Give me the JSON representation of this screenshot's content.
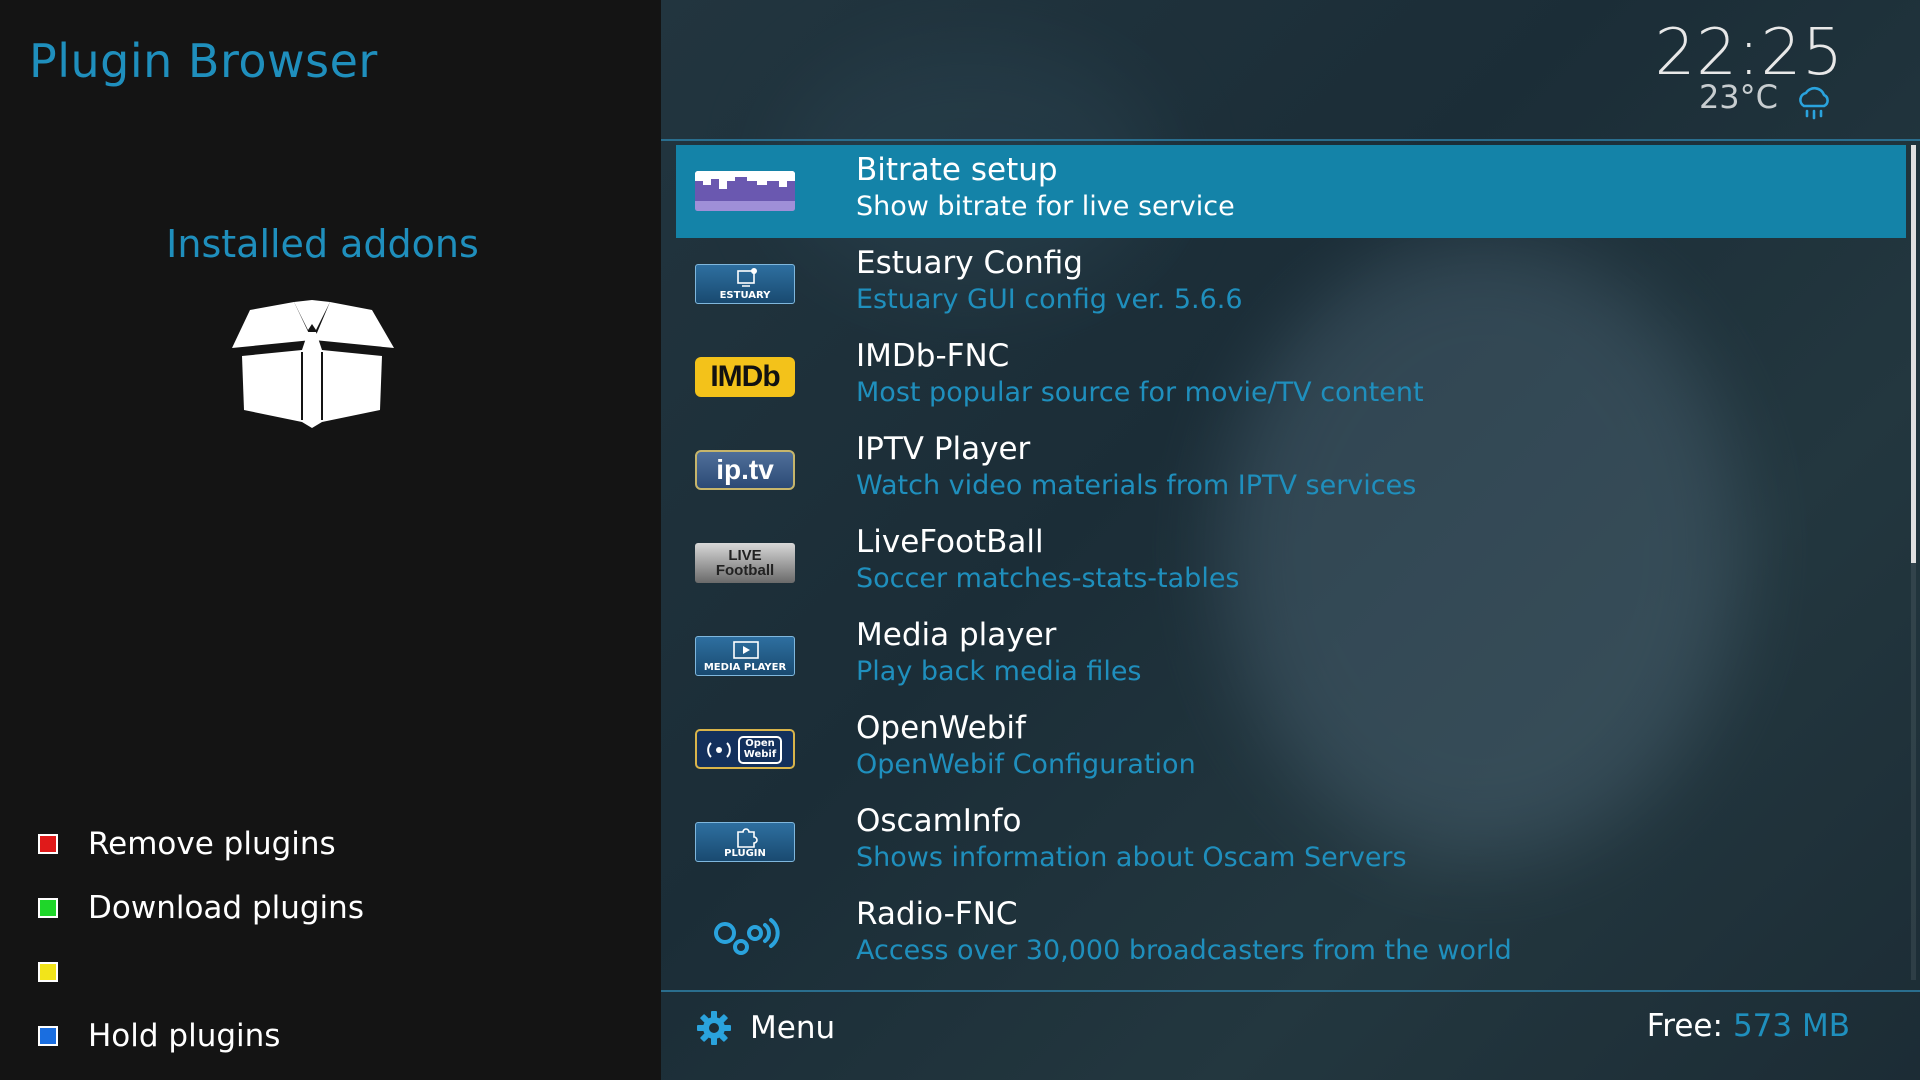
{
  "sidebar": {
    "title": "Plugin Browser",
    "section_title": "Installed addons",
    "section_icon": "open-box-icon",
    "color_keys": [
      {
        "color": "#e01a1a",
        "label": "Remove plugins"
      },
      {
        "color": "#1fd62a",
        "label": "Download plugins"
      },
      {
        "color": "#f2e41a",
        "label": ""
      },
      {
        "color": "#1a6ee0",
        "label": "Hold plugins"
      }
    ]
  },
  "header": {
    "time": "22:25",
    "temperature": "23°C",
    "weather_icon": "rain-cloud-icon"
  },
  "plugins": [
    {
      "name": "Bitrate setup",
      "description": "Show bitrate for live service",
      "icon": "bitrate-icon",
      "selected": true
    },
    {
      "name": "Estuary Config",
      "description": "Estuary GUI config ver. 5.6.6",
      "icon": "estuary-icon",
      "icon_text": "ESTUARY"
    },
    {
      "name": "IMDb-FNC",
      "description": "Most popular source for movie/TV content",
      "icon": "imdb-icon",
      "icon_text": "IMDb"
    },
    {
      "name": "IPTV Player",
      "description": "Watch video materials from IPTV services",
      "icon": "iptv-icon",
      "icon_text": "ip.tv"
    },
    {
      "name": "LiveFootBall",
      "description": "Soccer matches-stats-tables",
      "icon": "live-football-icon",
      "icon_text": "LIVE Football"
    },
    {
      "name": "Media player",
      "description": "Play back media files",
      "icon": "media-player-icon",
      "icon_text": "MEDIA PLAYER"
    },
    {
      "name": "OpenWebif",
      "description": "OpenWebif Configuration",
      "icon": "openwebif-icon",
      "icon_text": "Open Webif"
    },
    {
      "name": "OscamInfo",
      "description": "Shows information about Oscam Servers",
      "icon": "plugin-icon",
      "icon_text": "PLUGIN"
    },
    {
      "name": "Radio-FNC",
      "description": "Access over 30,000 broadcasters from the world",
      "icon": "radio-icon"
    }
  ],
  "footer": {
    "menu_label": "Menu",
    "free_label": "Free:",
    "free_value": "573 MB"
  },
  "colors": {
    "accent": "#1f8fbd",
    "selection": "#1483a8",
    "sidebar_bg": "#141414"
  }
}
